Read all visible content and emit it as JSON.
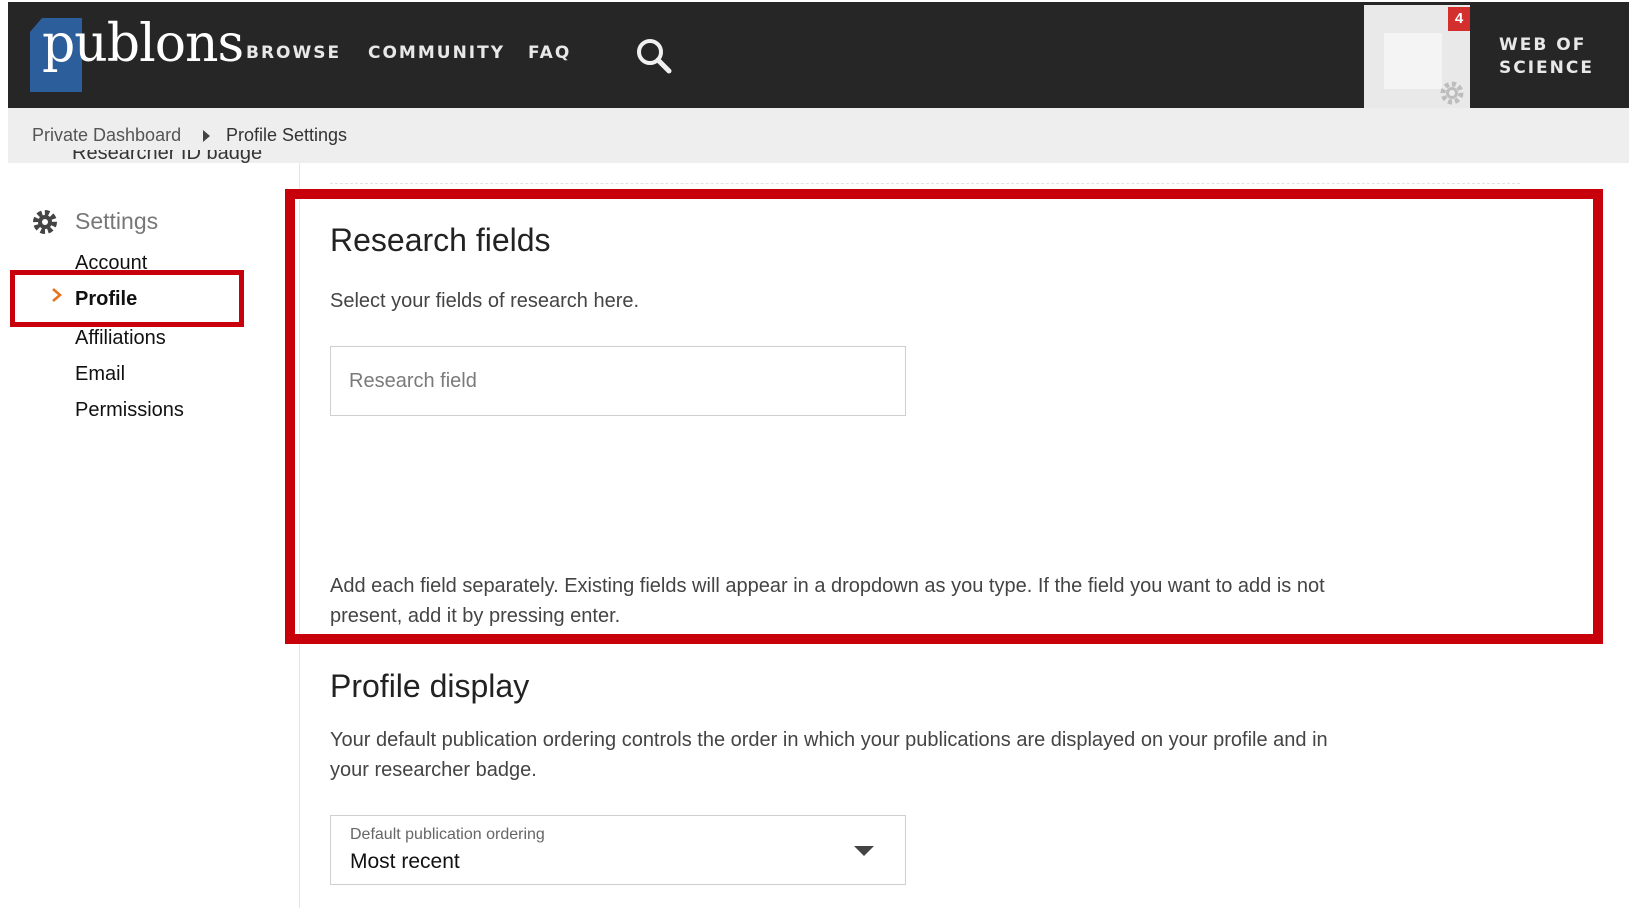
{
  "header": {
    "logo_text": "publons",
    "nav": [
      "BROWSE",
      "COMMUNITY",
      "FAQ"
    ],
    "notification_count": "4",
    "wos_line1": "WEB OF",
    "wos_line2": "SCIENCE",
    "bar_color": "#262626",
    "logo_color": "#2c5e9b"
  },
  "breadcrumb": {
    "parent": "Private Dashboard",
    "current": "Profile Settings",
    "cut_off_item": "Researcher ID badge"
  },
  "sidebar": {
    "section_title": "Settings",
    "items": [
      {
        "label": "Account",
        "active": false
      },
      {
        "label": "Profile",
        "active": true
      },
      {
        "label": "Affiliations",
        "active": false
      },
      {
        "label": "Email",
        "active": false
      },
      {
        "label": "Permissions",
        "active": false
      }
    ]
  },
  "research_fields": {
    "title": "Research fields",
    "description": "Select your fields of research here.",
    "input_placeholder": "Research field",
    "help_line1": "Add each field separately. Existing fields will appear in a dropdown as you type. If the field you want to add is not",
    "help_line2": "present, add it by pressing enter."
  },
  "profile_display": {
    "title": "Profile display",
    "desc_line1": "Your default publication ordering controls the order in which your publications are displayed on your profile and in",
    "desc_line2": "your researcher badge.",
    "select_label": "Default publication ordering",
    "select_value": "Most recent"
  },
  "highlight_color": "#c8000b"
}
